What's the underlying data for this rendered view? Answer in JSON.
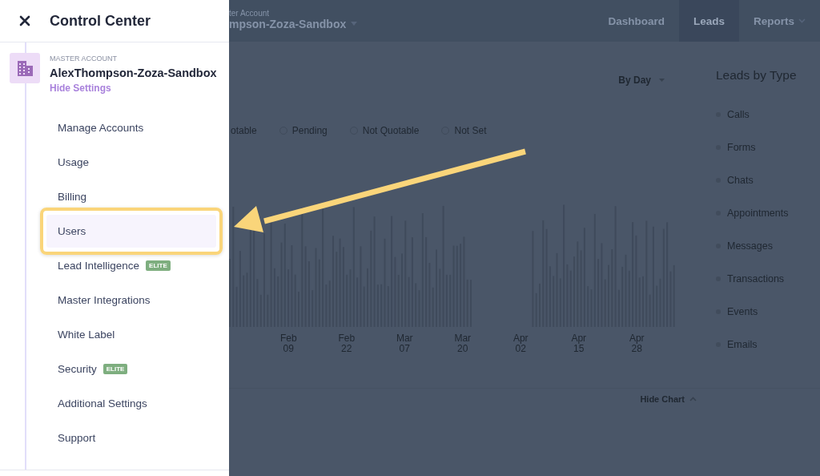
{
  "control_center": {
    "title": "Control Center",
    "account": {
      "label": "MASTER ACCOUNT",
      "name": "AlexThompson-Zoza-Sandbox",
      "toggle": "Hide Settings"
    },
    "items": [
      {
        "label": "Manage Accounts",
        "selected": false,
        "annotated": false
      },
      {
        "label": "Usage",
        "selected": false,
        "annotated": false
      },
      {
        "label": "Billing",
        "selected": false,
        "annotated": false
      },
      {
        "label": "Users",
        "selected": true,
        "annotated": true
      },
      {
        "label": "Lead Intelligence",
        "badge": "ELITE",
        "selected": false,
        "annotated": false
      },
      {
        "label": "Master Integrations",
        "selected": false,
        "annotated": false
      },
      {
        "label": "White Label",
        "selected": false,
        "annotated": false
      },
      {
        "label": "Security",
        "badge": "ELITE",
        "selected": false,
        "annotated": false
      },
      {
        "label": "Additional Settings",
        "selected": false,
        "annotated": false
      },
      {
        "label": "Support",
        "selected": false,
        "annotated": false
      }
    ]
  },
  "background": {
    "account_label": "ter Account",
    "account_name": "mpson-Zoza-Sandbox",
    "nav": [
      {
        "label": "Dashboard",
        "selected": false,
        "dropdown": false
      },
      {
        "label": "Leads",
        "selected": true,
        "dropdown": false
      },
      {
        "label": "Reports",
        "selected": false,
        "dropdown": true
      }
    ],
    "period": "By Day",
    "legend": [
      "otable",
      "Pending",
      "Not Quotable",
      "Not Set"
    ],
    "x_labels": [
      [
        "Feb",
        "09"
      ],
      [
        "Feb",
        "22"
      ],
      [
        "Mar",
        "07"
      ],
      [
        "Mar",
        "20"
      ],
      [
        "Apr",
        "02"
      ],
      [
        "Apr",
        "15"
      ],
      [
        "Apr",
        "28"
      ]
    ],
    "types_title": "Leads by Type",
    "types": [
      "Calls",
      "Forms",
      "Chats",
      "Appointments",
      "Messages",
      "Transactions",
      "Events",
      "Emails"
    ],
    "hide_chart": "Hide Chart"
  }
}
